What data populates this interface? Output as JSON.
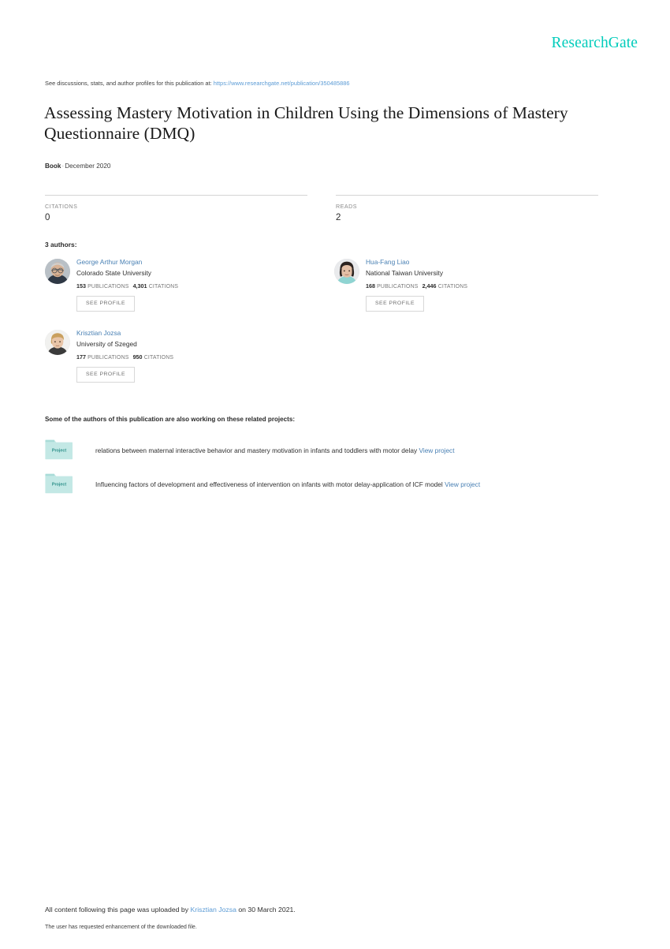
{
  "brand": {
    "logo_text": "ResearchGate",
    "logo_color": "#00ccbb"
  },
  "header": {
    "see_discussions_prefix": "See discussions, stats, and author profiles for this publication at:",
    "publication_url": "https://www.researchgate.net/publication/350485886"
  },
  "publication": {
    "title": "Assessing Mastery Motivation in Children Using the Dimensions of Mastery Questionnaire (DMQ)",
    "type": "Book",
    "separator": "·",
    "date": "December 2020"
  },
  "metrics": [
    {
      "label": "CITATIONS",
      "value": "0"
    },
    {
      "label": "READS",
      "value": "2"
    }
  ],
  "authors_section": {
    "heading": "3 authors:",
    "see_profile_label": "SEE PROFILE",
    "publications_label": "PUBLICATIONS",
    "citations_label": "CITATIONS",
    "authors": [
      {
        "name": "George Arthur Morgan",
        "affiliation": "Colorado State University",
        "publications": "153",
        "citations": "4,301",
        "avatar_icon": "avatar-photo-male-glasses"
      },
      {
        "name": "Hua-Fang Liao",
        "affiliation": "National Taiwan University",
        "publications": "168",
        "citations": "2,446",
        "avatar_icon": "avatar-photo-female-bob"
      },
      {
        "name": "Krisztian Jozsa",
        "affiliation": "University of Szeged",
        "publications": "177",
        "citations": "950",
        "avatar_icon": "avatar-photo-male-blond"
      }
    ]
  },
  "projects_section": {
    "heading": "Some of the authors of this publication are also working on these related projects:",
    "folder_icon_label": "Project",
    "view_project_label": "View project",
    "projects": [
      {
        "title": "relations between maternal interactive behavior and mastery motivation in infants and toddlers with motor delay"
      },
      {
        "title": "Influencing factors of development and effectiveness of intervention on infants with motor delay-application of ICF model"
      }
    ]
  },
  "footer": {
    "upload_prefix": "All content following this page was uploaded by",
    "uploader": "Krisztian Jozsa",
    "upload_suffix": "on 30 March 2021.",
    "enhancement_note": "The user has requested enhancement of the downloaded file."
  }
}
